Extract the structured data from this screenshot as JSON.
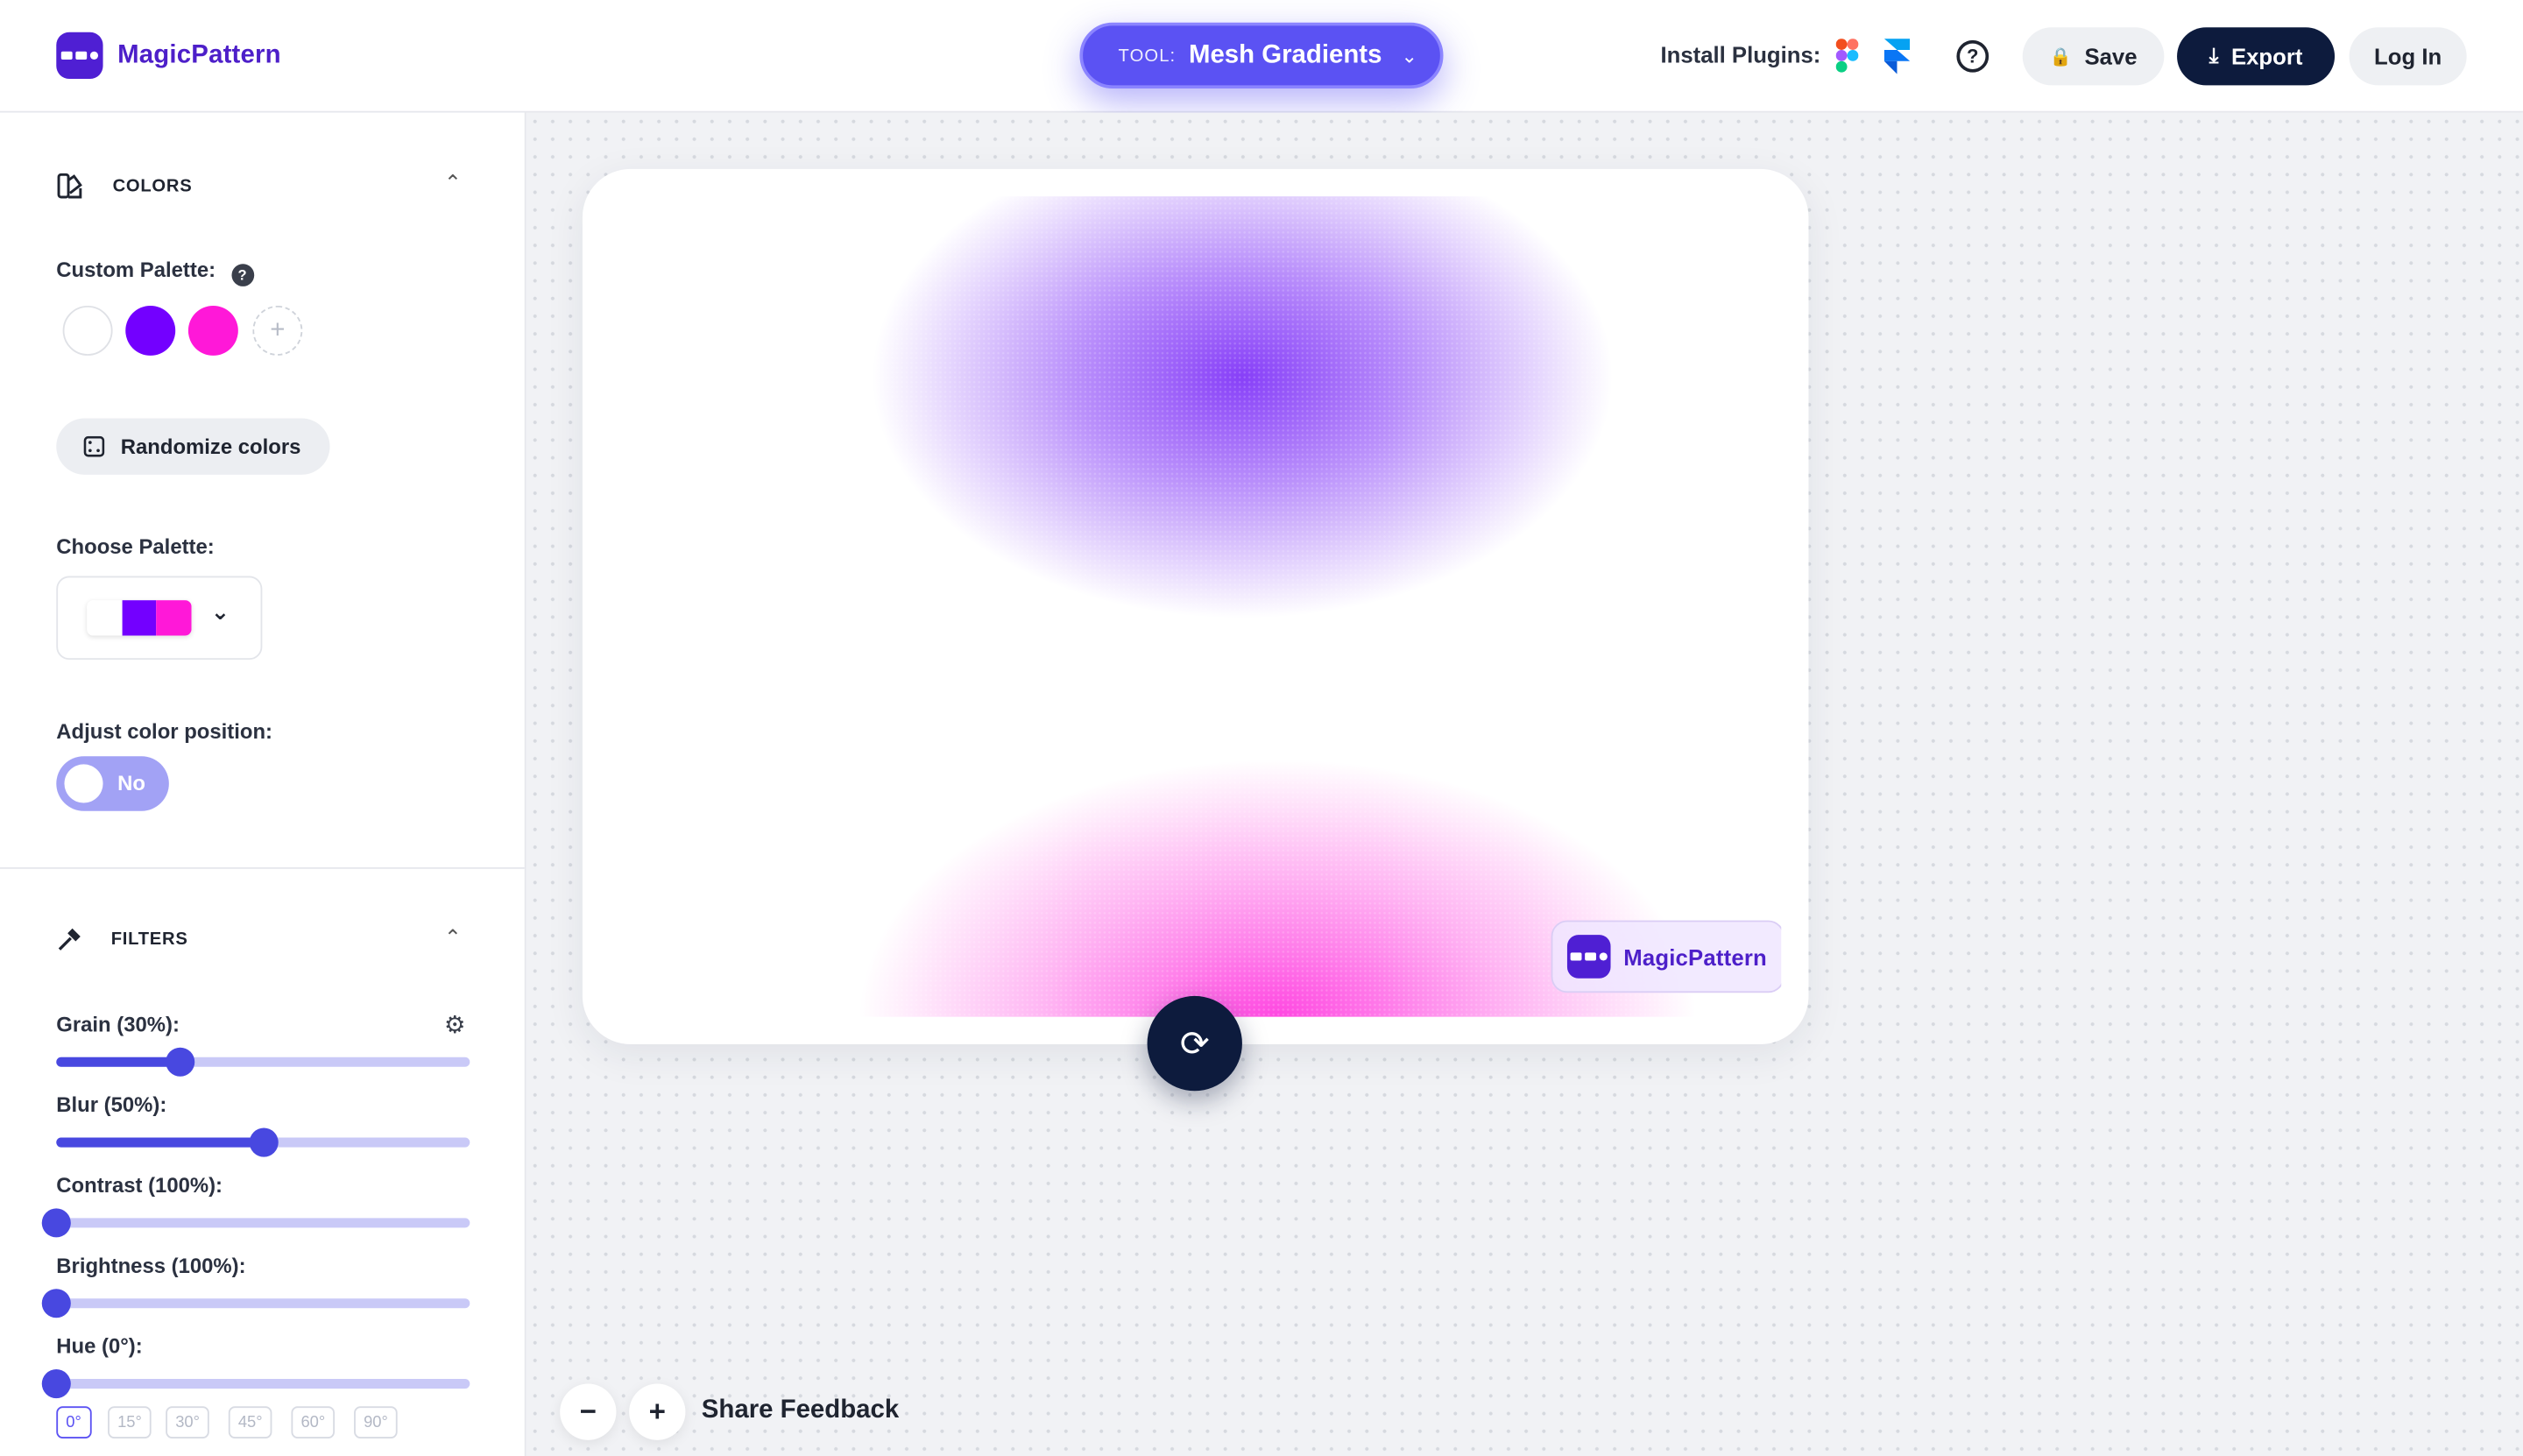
{
  "header": {
    "brand": "MagicPattern",
    "tool_label": "TOOL:",
    "tool_value": "Mesh Gradients",
    "install_plugins": "Install Plugins:",
    "save": "Save",
    "export": "Export",
    "login": "Log In"
  },
  "sidebar": {
    "colors": {
      "title": "COLORS",
      "custom_palette": "Custom Palette:",
      "swatches": [
        "#ffffff",
        "#7300ff",
        "#ff18d8"
      ],
      "randomize": "Randomize colors",
      "choose_palette": "Choose Palette:",
      "adjust_position": "Adjust color position:",
      "toggle_value": "No"
    },
    "filters": {
      "title": "FILTERS",
      "grain": "Grain (30%):",
      "grain_value": 30,
      "blur": "Blur (50%):",
      "blur_value": 50,
      "contrast": "Contrast (100%):",
      "contrast_value": 0,
      "brightness": "Brightness (100%):",
      "brightness_value": 0,
      "hue": "Hue (0°):",
      "hue_value": 0,
      "hue_presets": [
        "0°",
        "15°",
        "30°",
        "45°",
        "60°",
        "90°"
      ]
    }
  },
  "canvas": {
    "watermark": "MagicPattern",
    "share_feedback": "Share Feedback"
  },
  "colors": {
    "accent": "#5b52f3",
    "dark": "#0d1b3d",
    "brand_purple": "#4f1fd3"
  }
}
